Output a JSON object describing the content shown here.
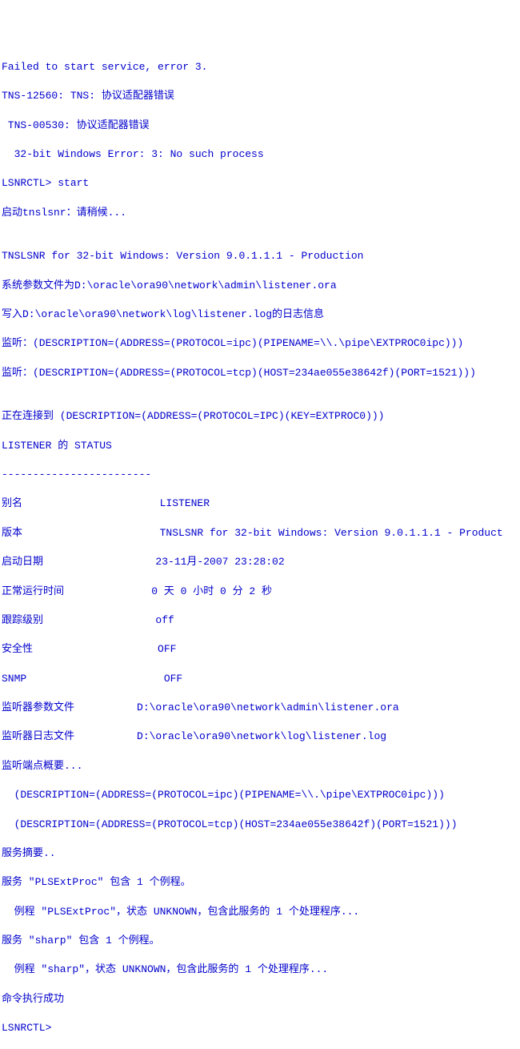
{
  "lines": [
    "Failed to start service, error 3.",
    "TNS-12560: TNS: 协议适配器错误",
    " TNS-00530: 协议适配器错误",
    "  32-bit Windows Error: 3: No such process",
    "LSNRCTL> start",
    "启动tnslsnr：请稍候...",
    "",
    "TNSLSNR for 32-bit Windows: Version 9.0.1.1.1 - Production",
    "系统参数文件为D:\\oracle\\ora90\\network\\admin\\listener.ora",
    "写入D:\\oracle\\ora90\\network\\log\\listener.log的日志信息",
    "监听：(DESCRIPTION=(ADDRESS=(PROTOCOL=ipc)(PIPENAME=\\\\.\\pipe\\EXTPROC0ipc)))",
    "监听：(DESCRIPTION=(ADDRESS=(PROTOCOL=tcp)(HOST=234ae055e38642f)(PORT=1521)))",
    "",
    "正在连接到 (DESCRIPTION=(ADDRESS=(PROTOCOL=IPC)(KEY=EXTPROC0)))",
    "LISTENER 的 STATUS",
    "------------------------",
    "别名                      LISTENER",
    "版本                      TNSLSNR for 32-bit Windows: Version 9.0.1.1.1 - Product",
    "启动日期                  23-11月-2007 23:28:02",
    "正常运行时间              0 天 0 小时 0 分 2 秒",
    "跟踪级别                  off",
    "安全性                    OFF",
    "SNMP                      OFF",
    "监听器参数文件          D:\\oracle\\ora90\\network\\admin\\listener.ora",
    "监听器日志文件          D:\\oracle\\ora90\\network\\log\\listener.log",
    "监听端点概要...",
    "  (DESCRIPTION=(ADDRESS=(PROTOCOL=ipc)(PIPENAME=\\\\.\\pipe\\EXTPROC0ipc)))",
    "  (DESCRIPTION=(ADDRESS=(PROTOCOL=tcp)(HOST=234ae055e38642f)(PORT=1521)))",
    "服务摘要..",
    "服务 \"PLSExtProc\" 包含 1 个例程。",
    "  例程 \"PLSExtProc\"，状态 UNKNOWN，包含此服务的 1 个处理程序...",
    "服务 \"sharp\" 包含 1 个例程。",
    "  例程 \"sharp\"，状态 UNKNOWN，包含此服务的 1 个处理程序...",
    "命令执行成功",
    "LSNRCTL>"
  ]
}
